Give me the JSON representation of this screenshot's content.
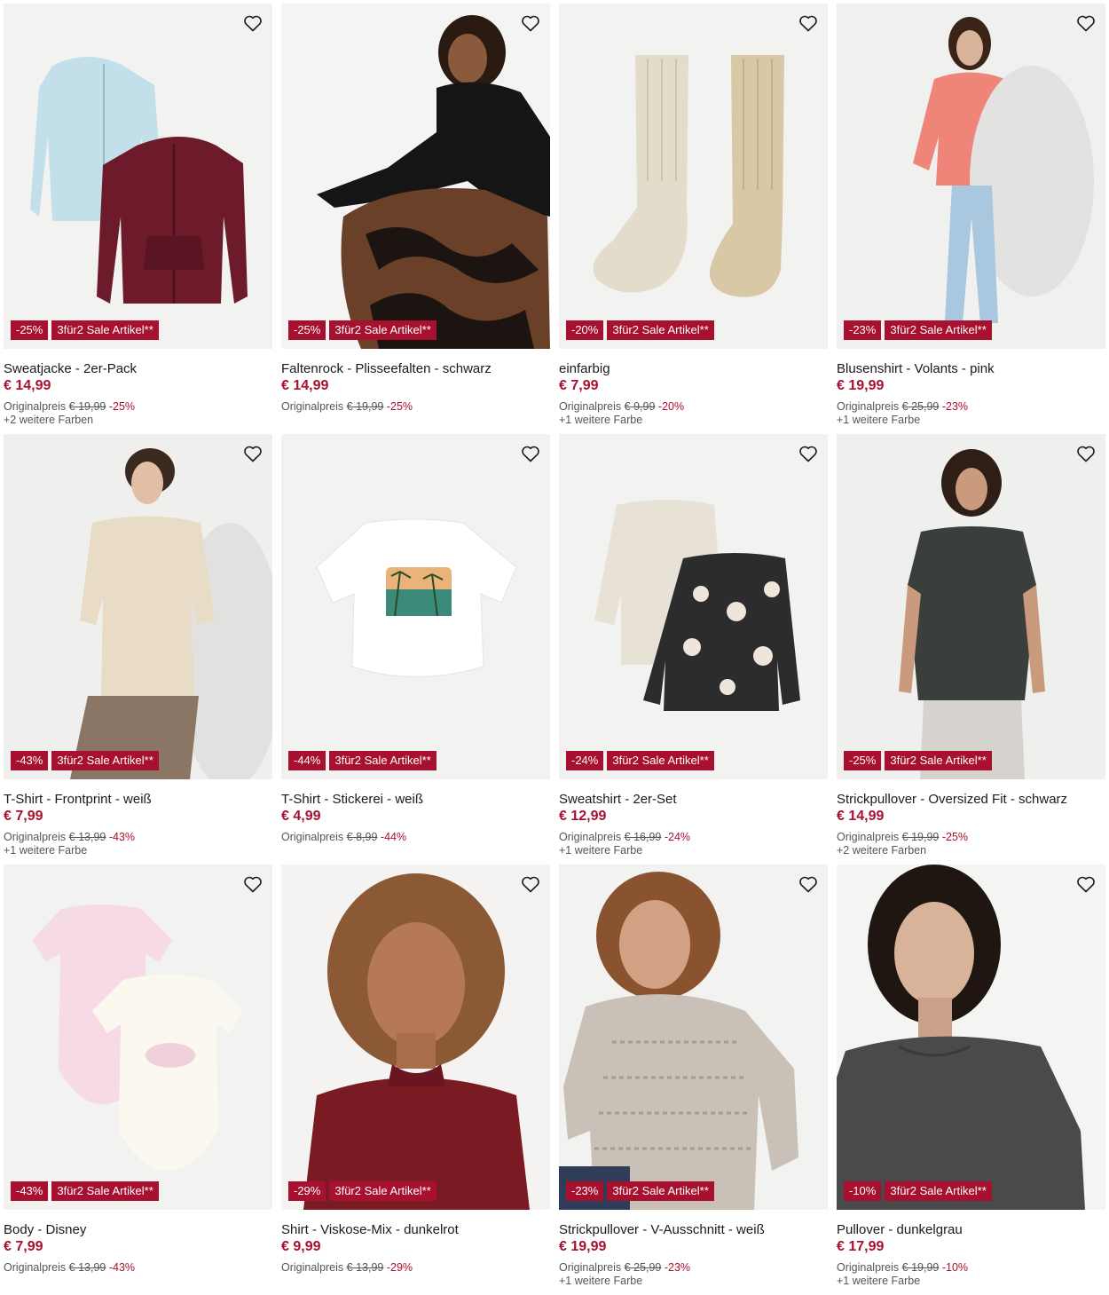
{
  "products": [
    {
      "name": "Sweatjacke - 2er-Pack",
      "price": "€ 14,99",
      "orig_label": "Originalpreis",
      "orig_price": "€ 19,99",
      "pct": "-25%",
      "discount_badge": "-25%",
      "promo_badge": "3für2 Sale Artikel**",
      "colors": "+2 weitere Farben",
      "image": "two zip hoodies light blue and burgundy"
    },
    {
      "name": "Faltenrock - Plisseefalten - schwarz",
      "price": "€ 14,99",
      "orig_label": "Originalpreis",
      "orig_price": "€ 19,99",
      "pct": "-25%",
      "discount_badge": "-25%",
      "promo_badge": "3für2 Sale Artikel**",
      "colors": "",
      "image": "model in black top and patterned pleated skirt"
    },
    {
      "name": "einfarbig",
      "price": "€ 7,99",
      "orig_label": "Originalpreis",
      "orig_price": "€ 9,99",
      "pct": "-20%",
      "discount_badge": "-20%",
      "promo_badge": "3für2 Sale Artikel**",
      "colors": "+1 weitere Farbe",
      "image": "pair of beige knitted socks"
    },
    {
      "name": "Blusenshirt - Volants - pink",
      "price": "€ 19,99",
      "orig_label": "Originalpreis",
      "orig_price": "€ 25,99",
      "pct": "-23%",
      "discount_badge": "-23%",
      "promo_badge": "3für2 Sale Artikel**",
      "colors": "+1 weitere Farbe",
      "image": "model in pink blouse and light jeans"
    },
    {
      "name": "T-Shirt - Frontprint - weiß",
      "price": "€ 7,99",
      "orig_label": "Originalpreis",
      "orig_price": "€ 13,99",
      "pct": "-43%",
      "discount_badge": "-43%",
      "promo_badge": "3für2 Sale Artikel**",
      "colors": "+1 weitere Farbe",
      "image": "model in beige t-shirt"
    },
    {
      "name": "T-Shirt - Stickerei - weiß",
      "price": "€ 4,99",
      "orig_label": "Originalpreis",
      "orig_price": "€ 8,99",
      "pct": "-44%",
      "discount_badge": "-44%",
      "promo_badge": "3für2 Sale Artikel**",
      "colors": "",
      "image": "white cropped t-shirt with beach print"
    },
    {
      "name": "Sweatshirt - 2er-Set",
      "price": "€ 12,99",
      "orig_label": "Originalpreis",
      "orig_price": "€ 16,99",
      "pct": "-24%",
      "discount_badge": "-24%",
      "promo_badge": "3für2 Sale Artikel**",
      "colors": "+1 weitere Farbe",
      "image": "two sweatshirts cream and dark grey"
    },
    {
      "name": "Strickpullover - Oversized Fit - schwarz",
      "price": "€ 14,99",
      "orig_label": "Originalpreis",
      "orig_price": "€ 19,99",
      "pct": "-25%",
      "discount_badge": "-25%",
      "promo_badge": "3für2 Sale Artikel**",
      "colors": "+2 weitere Farben",
      "image": "model in dark knitted vest"
    },
    {
      "name": "Body - Disney",
      "price": "€ 7,99",
      "orig_label": "Originalpreis",
      "orig_price": "€ 13,99",
      "pct": "-43%",
      "discount_badge": "-43%",
      "promo_badge": "3für2 Sale Artikel**",
      "colors": "",
      "image": "two baby bodysuits pink and white"
    },
    {
      "name": "Shirt - Viskose-Mix - dunkelrot",
      "price": "€ 9,99",
      "orig_label": "Originalpreis",
      "orig_price": "€ 13,99",
      "pct": "-29%",
      "discount_badge": "-29%",
      "promo_badge": "3für2 Sale Artikel**",
      "colors": "",
      "image": "model in dark red shirt"
    },
    {
      "name": "Strickpullover - V-Ausschnitt - weiß",
      "price": "€ 19,99",
      "orig_label": "Originalpreis",
      "orig_price": "€ 25,99",
      "pct": "-23%",
      "discount_badge": "-23%",
      "promo_badge": "3für2 Sale Artikel**",
      "colors": "+1 weitere Farbe",
      "image": "model in melange knitted sweater"
    },
    {
      "name": "Pullover - dunkelgrau",
      "price": "€ 17,99",
      "orig_label": "Originalpreis",
      "orig_price": "€ 19,99",
      "pct": "-10%",
      "discount_badge": "-10%",
      "promo_badge": "3für2 Sale Artikel**",
      "colors": "+1 weitere Farbe",
      "image": "model in dark grey pullover"
    }
  ],
  "colors": {
    "accent": "#a8102f",
    "image_bg": "#f2f2f0",
    "text": "#1a1a1a",
    "muted": "#555555"
  },
  "icons": {
    "wishlist": "heart-outline-icon"
  }
}
